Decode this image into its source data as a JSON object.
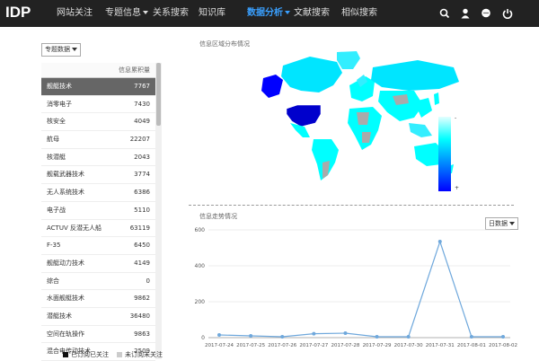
{
  "app": {
    "logo": "IDP"
  },
  "nav": [
    {
      "label": "网站关注"
    },
    {
      "label": "专题信息"
    },
    {
      "label": "关系搜索"
    },
    {
      "label": "知识库"
    },
    {
      "label": "数据分析"
    },
    {
      "label": "文献搜索"
    },
    {
      "label": "相似搜索"
    }
  ],
  "left": {
    "dropdown": "专题数据",
    "column_header": "信息累积量",
    "rows": [
      {
        "name": "舰艇技术",
        "value": "7767"
      },
      {
        "name": "消零电子",
        "value": "7430"
      },
      {
        "name": "核安全",
        "value": "4049"
      },
      {
        "name": "航母",
        "value": "22207"
      },
      {
        "name": "核潜艇",
        "value": "2043"
      },
      {
        "name": "舰载武器技术",
        "value": "3774"
      },
      {
        "name": "无人系统技术",
        "value": "6386"
      },
      {
        "name": "电子战",
        "value": "5110"
      },
      {
        "name": "ACTUV 反潜无人船",
        "value": "63119"
      },
      {
        "name": "F-35",
        "value": "6450"
      },
      {
        "name": "舰艇动力技术",
        "value": "4149"
      },
      {
        "name": "综合",
        "value": "0"
      },
      {
        "name": "水面舰艇技术",
        "value": "9862"
      },
      {
        "name": "潜艇技术",
        "value": "36480"
      },
      {
        "name": "空间在轨操作",
        "value": "9863"
      },
      {
        "name": "混合电传动技术",
        "value": "2509"
      }
    ],
    "legend_followed": "已订阅已关注",
    "legend_unfollowed": "未订阅未关注"
  },
  "map": {
    "title": "信息区域分布情况",
    "scale_max": "-",
    "scale_min": "+",
    "colors": {
      "high": "#0000ff",
      "mid": "#00ffff",
      "low": "#aaaaaa"
    }
  },
  "trend": {
    "title": "信息走势情况",
    "period": "日数据"
  },
  "chart_data": {
    "type": "line",
    "title": "信息走势情况",
    "x": [
      "2017-07-24",
      "2017-07-25",
      "2017-07-26",
      "2017-07-27",
      "2017-07-28",
      "2017-07-29",
      "2017-07-30",
      "2017-07-31",
      "2017-08-01",
      "2017-08-02"
    ],
    "y_ticks": [
      "0",
      "200",
      "400",
      "600"
    ],
    "series": [
      {
        "values": [
          15,
          10,
          5,
          22,
          25,
          5,
          5,
          535,
          5,
          5
        ]
      }
    ],
    "ylim": [
      0,
      600
    ],
    "color": "#6fa8dc"
  }
}
